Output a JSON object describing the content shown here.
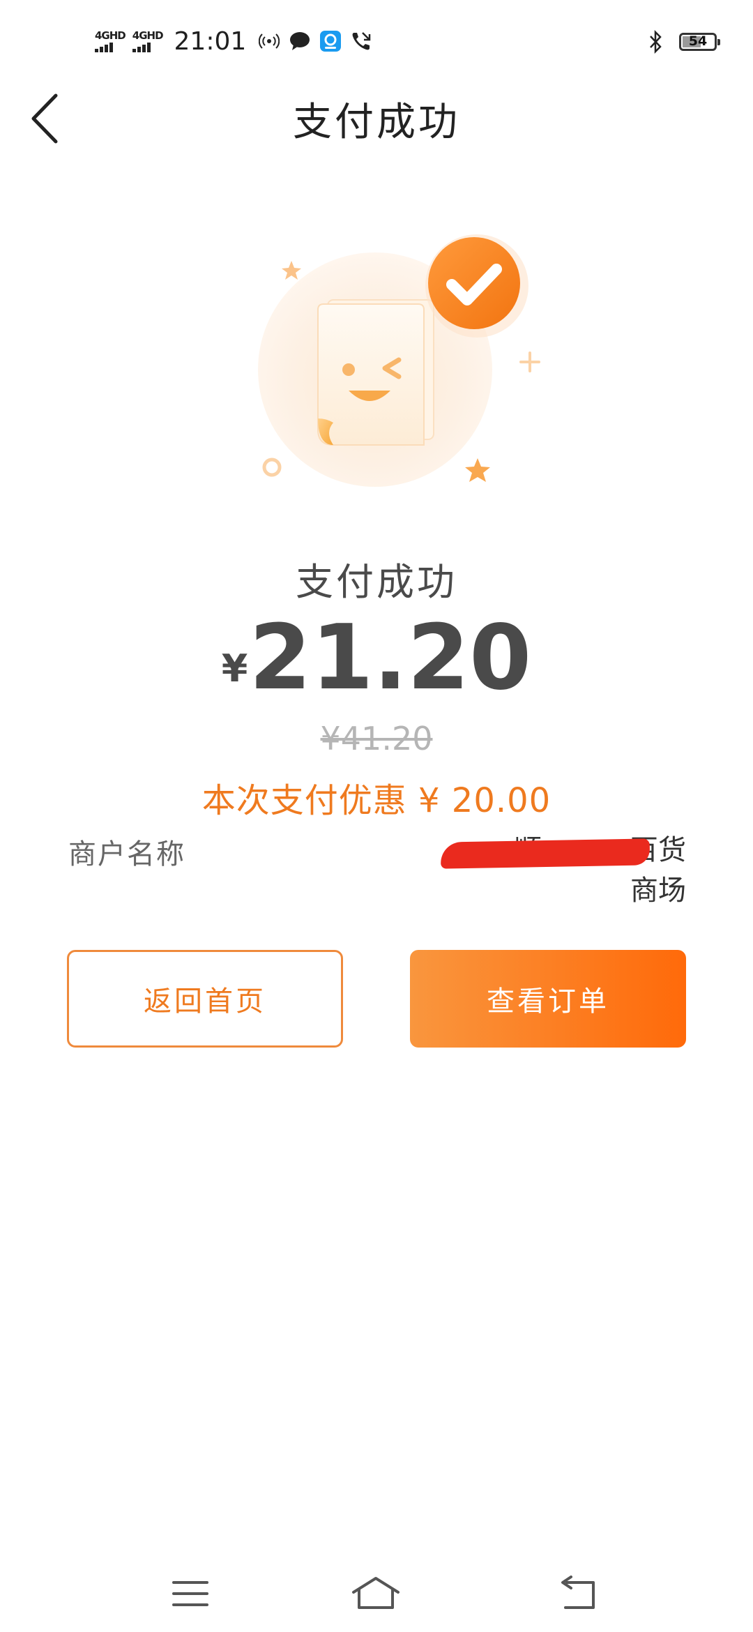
{
  "status_bar": {
    "network1": "4GHD",
    "network2": "4GHD",
    "time": "21:01",
    "battery": "54"
  },
  "header": {
    "title": "支付成功"
  },
  "result": {
    "title": "支付成功",
    "currency": "¥",
    "amount": "21.20",
    "original_price": "¥41.20",
    "discount_text": "本次支付优惠 ¥ 20.00"
  },
  "merchant": {
    "label": "商户名称",
    "value_line1": "顺          百货",
    "value_line2": "商场"
  },
  "buttons": {
    "home": "返回首页",
    "view_order": "查看订单"
  },
  "colors": {
    "accent": "#ef7a1f",
    "button_gradient_start": "#f9963e",
    "button_gradient_end": "#ff6a0a",
    "redaction": "#ea2a1e"
  },
  "icons": {
    "back": "chevron-left-icon",
    "success": "check-circle-icon",
    "menu": "menu-icon",
    "home": "home-icon",
    "return": "return-icon"
  }
}
